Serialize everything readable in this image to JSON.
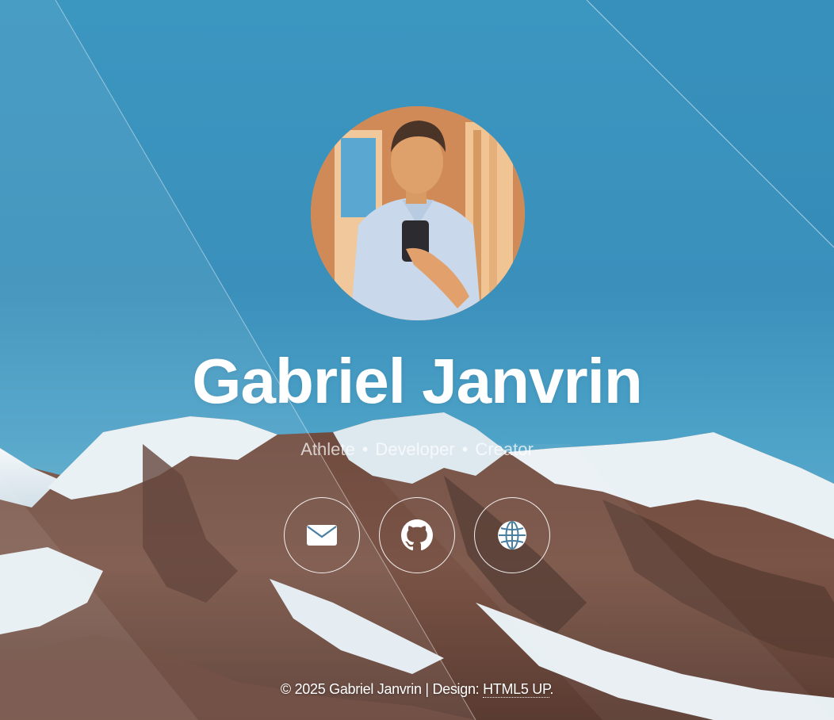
{
  "profile": {
    "name": "Gabriel Janvrin",
    "tagline": [
      "Athlete",
      "Developer",
      "Creator"
    ],
    "tagline_separator": "•"
  },
  "links": [
    {
      "icon": "envelope-icon",
      "label": "Email"
    },
    {
      "icon": "github-icon",
      "label": "GitHub"
    },
    {
      "icon": "globe-icon",
      "label": "Website"
    }
  ],
  "footer": {
    "copyright": "© 2025 Gabriel Janvrin | Design: ",
    "design_link": "HTML5 UP",
    "suffix": "."
  },
  "colors": {
    "sky": "#3a90bb",
    "text": "#ffffff"
  }
}
